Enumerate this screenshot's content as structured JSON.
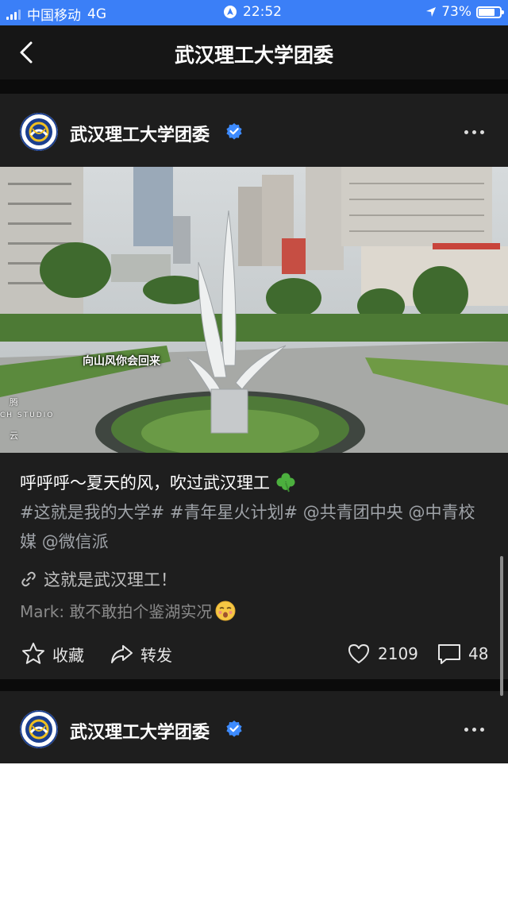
{
  "status_bar": {
    "carrier": "中国移动",
    "network": "4G",
    "time": "22:52",
    "battery": "73%"
  },
  "nav": {
    "title": "武汉理工大学团委"
  },
  "posts": [
    {
      "account": "武汉理工大学团委",
      "video": {
        "caption": "向山风你会回来",
        "watermark_top": "腾",
        "watermark_mid": "CH STUDIO",
        "watermark_bottom": "云"
      },
      "text_line1": "呼呼呼～夏天的风，吹过武汉理工",
      "tag1": "#这就是我的大学#",
      "tag2": "#青年星火计划#",
      "mention1": "@共青团中央",
      "mention2": "@中青校媒",
      "mention3": "@微信派",
      "link_text": "这就是武汉理工！",
      "mark_text": "Mark: 敢不敢拍个鉴湖实况",
      "actions": {
        "favorite": "收藏",
        "share": "转发",
        "likes": "2109",
        "comments": "48"
      }
    },
    {
      "account": "武汉理工大学团委"
    }
  ],
  "icons": [
    "back-chevron-icon",
    "verified-icon",
    "more-icon",
    "clover-emoji-icon",
    "link-icon",
    "emoji-icon",
    "star-icon",
    "share-icon",
    "heart-icon",
    "comment-icon"
  ],
  "colors": {
    "status_bar": "#3b7ff7",
    "verified": "#3d8bff",
    "background": "#1e1e1e"
  }
}
